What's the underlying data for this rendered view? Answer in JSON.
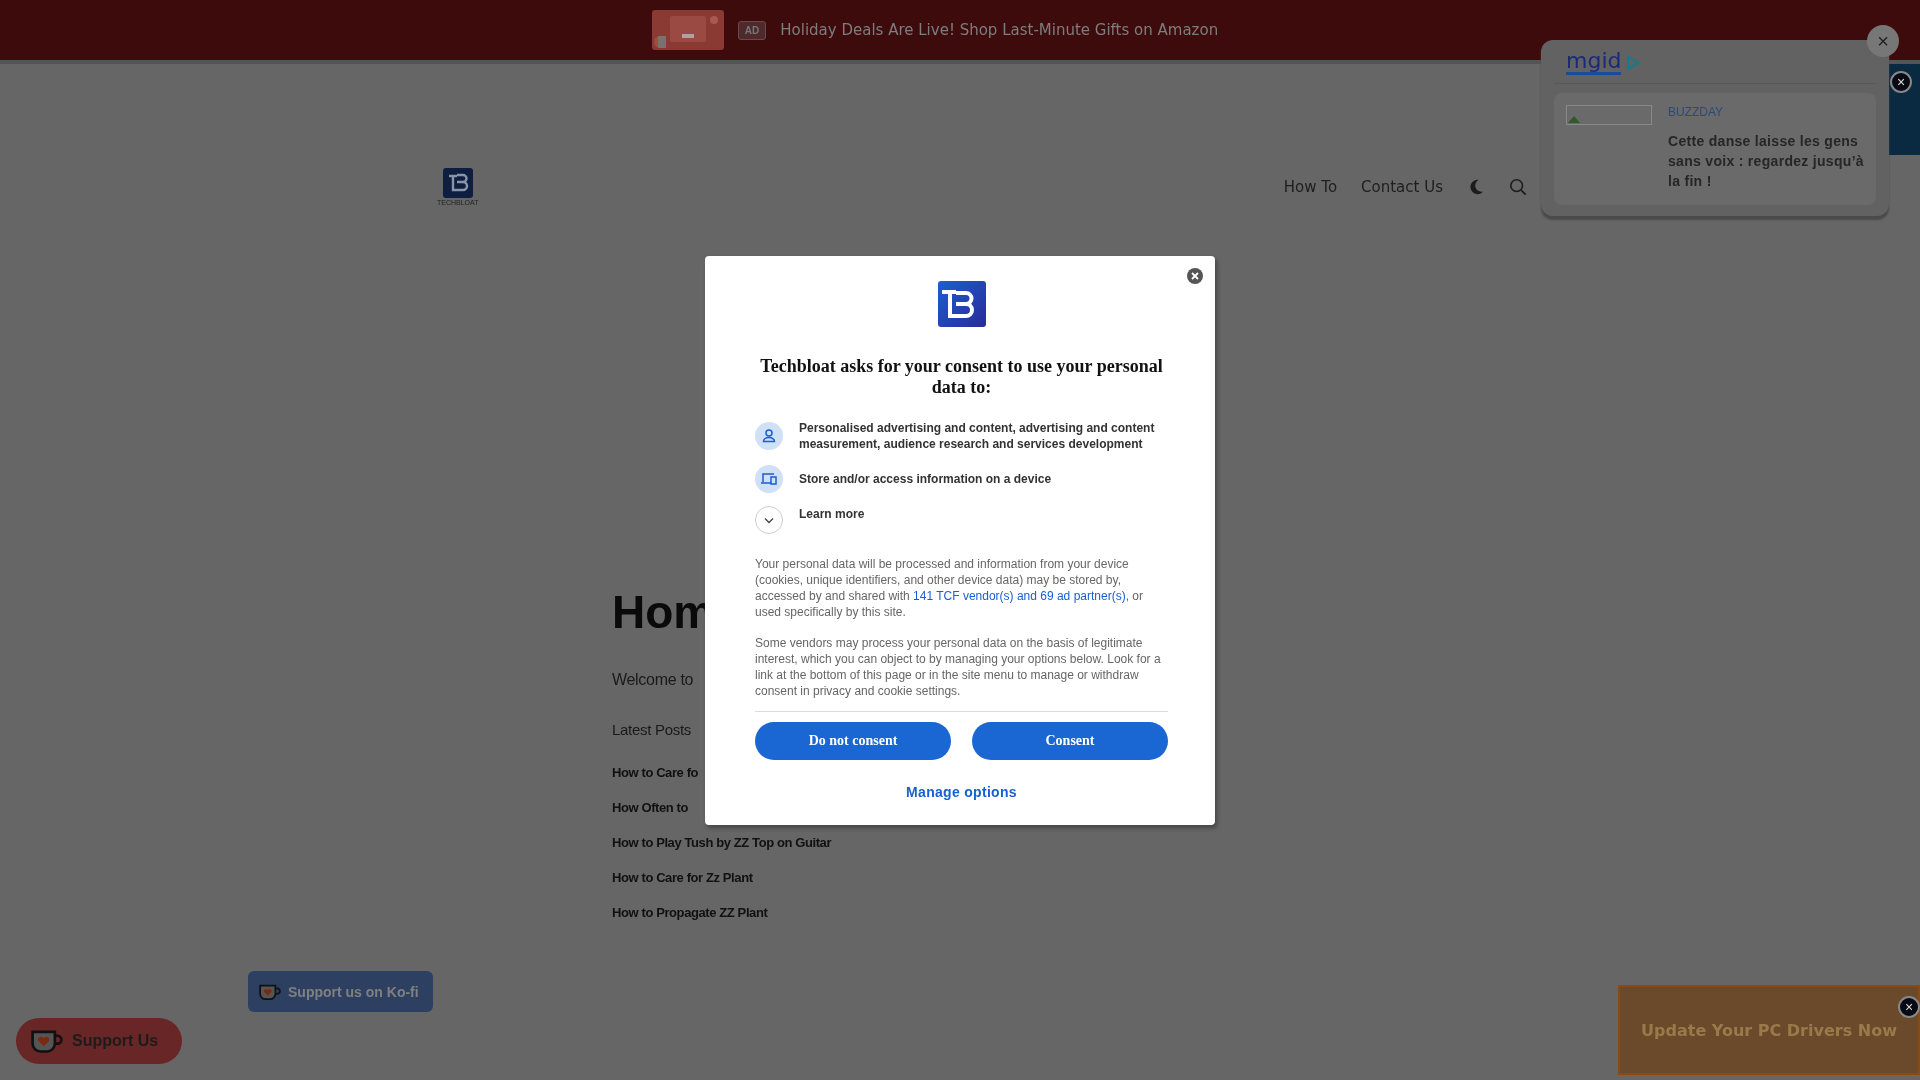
{
  "ad_banner": {
    "badge": "AD",
    "text": "Holiday Deals Are Live! Shop Last-Minute Gifts on Amazon"
  },
  "header": {
    "logo_caption": "TECHBLOAT",
    "nav": [
      "How To",
      "Contact Us"
    ]
  },
  "content": {
    "title": "Hom",
    "intro": "Welcome to",
    "section": "Latest Posts",
    "posts": [
      "How to Care fo",
      "How Often to",
      "How to Play Tush by ZZ Top on Guitar",
      "How to Care for Zz Plant",
      "How to Propagate ZZ Plant"
    ]
  },
  "consent_dialog": {
    "title": "Techbloat asks for your consent to use your personal data to:",
    "purposes": [
      {
        "kind": "person",
        "text": "Personalised advertising and content, advertising and content measurement, audience research and services development"
      },
      {
        "kind": "device",
        "text": "Store and/or access information on a device"
      },
      {
        "kind": "expand",
        "text": "Learn more"
      }
    ],
    "paragraph_1": {
      "before": "Your personal data will be processed and information from your device (cookies, unique identifiers, and other device data) may be stored by, accessed by and shared with ",
      "link": "141 TCF vendor(s) and 69 ad partner(s)",
      "after": ", or used specifically by this site."
    },
    "paragraph_2": "Some vendors may process your personal data on the basis of legitimate interest, which you can object to by managing your options below. Look for a link at the bottom of this page or in the site menu to manage or withdraw consent in privacy and cookie settings.",
    "buttons": [
      "Do not consent",
      "Consent"
    ],
    "manage_link": "Manage options"
  },
  "mgid_widget": {
    "logo": "mgid",
    "source": "BUZZDAY",
    "headline": "Cette danse laisse les gens sans voix : regardez jusqu’à la fin !"
  },
  "kofi": {
    "inline_button": "Support us on Ko-fi",
    "floating_button": "Support Us"
  },
  "bottom_ad": {
    "text": "Update Your PC Drivers Now"
  },
  "close_glyphs": {
    "blue_ad": "×",
    "mgid_widget": "×",
    "bottom_ad": "×"
  }
}
